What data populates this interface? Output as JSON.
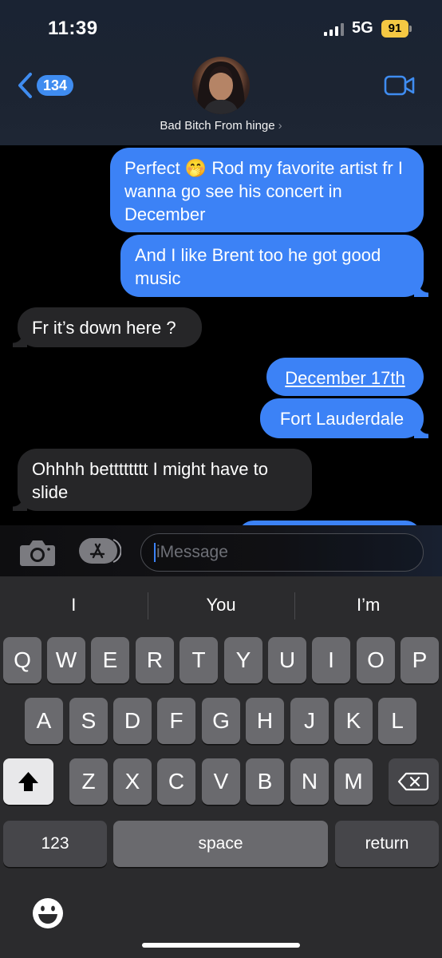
{
  "status": {
    "time": "11:39",
    "network": "5G",
    "battery": "91"
  },
  "header": {
    "back_count": "134",
    "contact_name": "Bad Bitch From hinge",
    "chevron": "›"
  },
  "messages": [
    {
      "dir": "out",
      "text": "Perfect 🤭 Rod my favorite artist fr I wanna go see his concert in December"
    },
    {
      "dir": "out",
      "text": "And I like Brent too he got good music"
    },
    {
      "dir": "in",
      "text": "Fr it’s down here ?"
    },
    {
      "dir": "out",
      "text": "December 17th"
    },
    {
      "dir": "out",
      "text": "Fort Lauderdale"
    },
    {
      "dir": "in",
      "text": "Ohhhh betttttttt I might have to slide"
    }
  ],
  "compose": {
    "placeholder": "iMessage"
  },
  "keyboard": {
    "suggestions": [
      "I",
      "You",
      "I’m"
    ],
    "row1": [
      "Q",
      "W",
      "E",
      "R",
      "T",
      "Y",
      "U",
      "I",
      "O",
      "P"
    ],
    "row2": [
      "A",
      "S",
      "D",
      "F",
      "G",
      "H",
      "J",
      "K",
      "L"
    ],
    "row3": [
      "Z",
      "X",
      "C",
      "V",
      "B",
      "N",
      "M"
    ],
    "numbers_label": "123",
    "space_label": "space",
    "return_label": "return"
  },
  "colors": {
    "outgoing": "#3c82f6",
    "incoming": "#262628",
    "badge": "#3f8cf0",
    "battery": "#f5c843"
  }
}
